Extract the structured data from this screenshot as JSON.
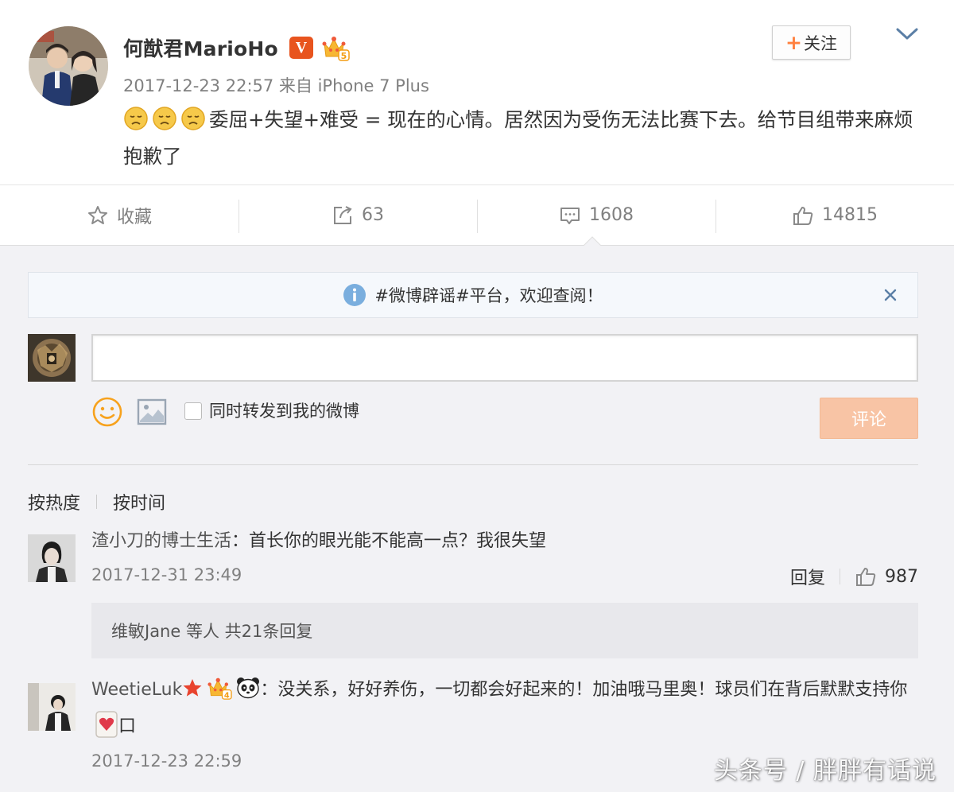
{
  "post": {
    "username": "何猷君MarioHo",
    "verified_badge": "V",
    "member_level": "5",
    "meta": "2017-12-23 22:57 来自 iPhone 7 Plus",
    "follow_label": "关注",
    "follow_plus": "+",
    "text": "委屈+失望+难受 = 现在的心情。居然因为受伤无法比赛下去。给节目组带来麻烦 抱歉了",
    "emoji": "sad-face-icon"
  },
  "actions": {
    "favorite_label": "收藏",
    "repost_count": "63",
    "comment_count": "1608",
    "like_count": "14815"
  },
  "notice": {
    "text": "#微博辟谣#平台，欢迎查阅！"
  },
  "composer": {
    "input_value": "",
    "repost_label": "同时转发到我的微博",
    "submit_label": "评论"
  },
  "sort": {
    "by_hot": "按热度",
    "by_time": "按时间"
  },
  "comments": [
    {
      "author": "渣小刀的博士生活",
      "text": "：首长你的眼光能不能高一点？我很失望",
      "time": "2017-12-31 23:49",
      "reply_label": "回复",
      "likes": "987",
      "replies_summary": "维敏Jane 等人 共21条回复"
    },
    {
      "author": "WeetieLuk",
      "member_level": "4",
      "text": "：没关系，好好养伤，一切都会好起来的！加油哦马里奥！球员们在背后默默支持你",
      "trailing": "口",
      "time": "2017-12-23 22:59"
    }
  ],
  "watermark": "头条号 / 胖胖有话说",
  "colors": {
    "accent_orange": "#ff8140",
    "verified_orange": "#e8541e",
    "submit_disabled": "#f8c4a5",
    "info_blue": "#7aaede"
  }
}
